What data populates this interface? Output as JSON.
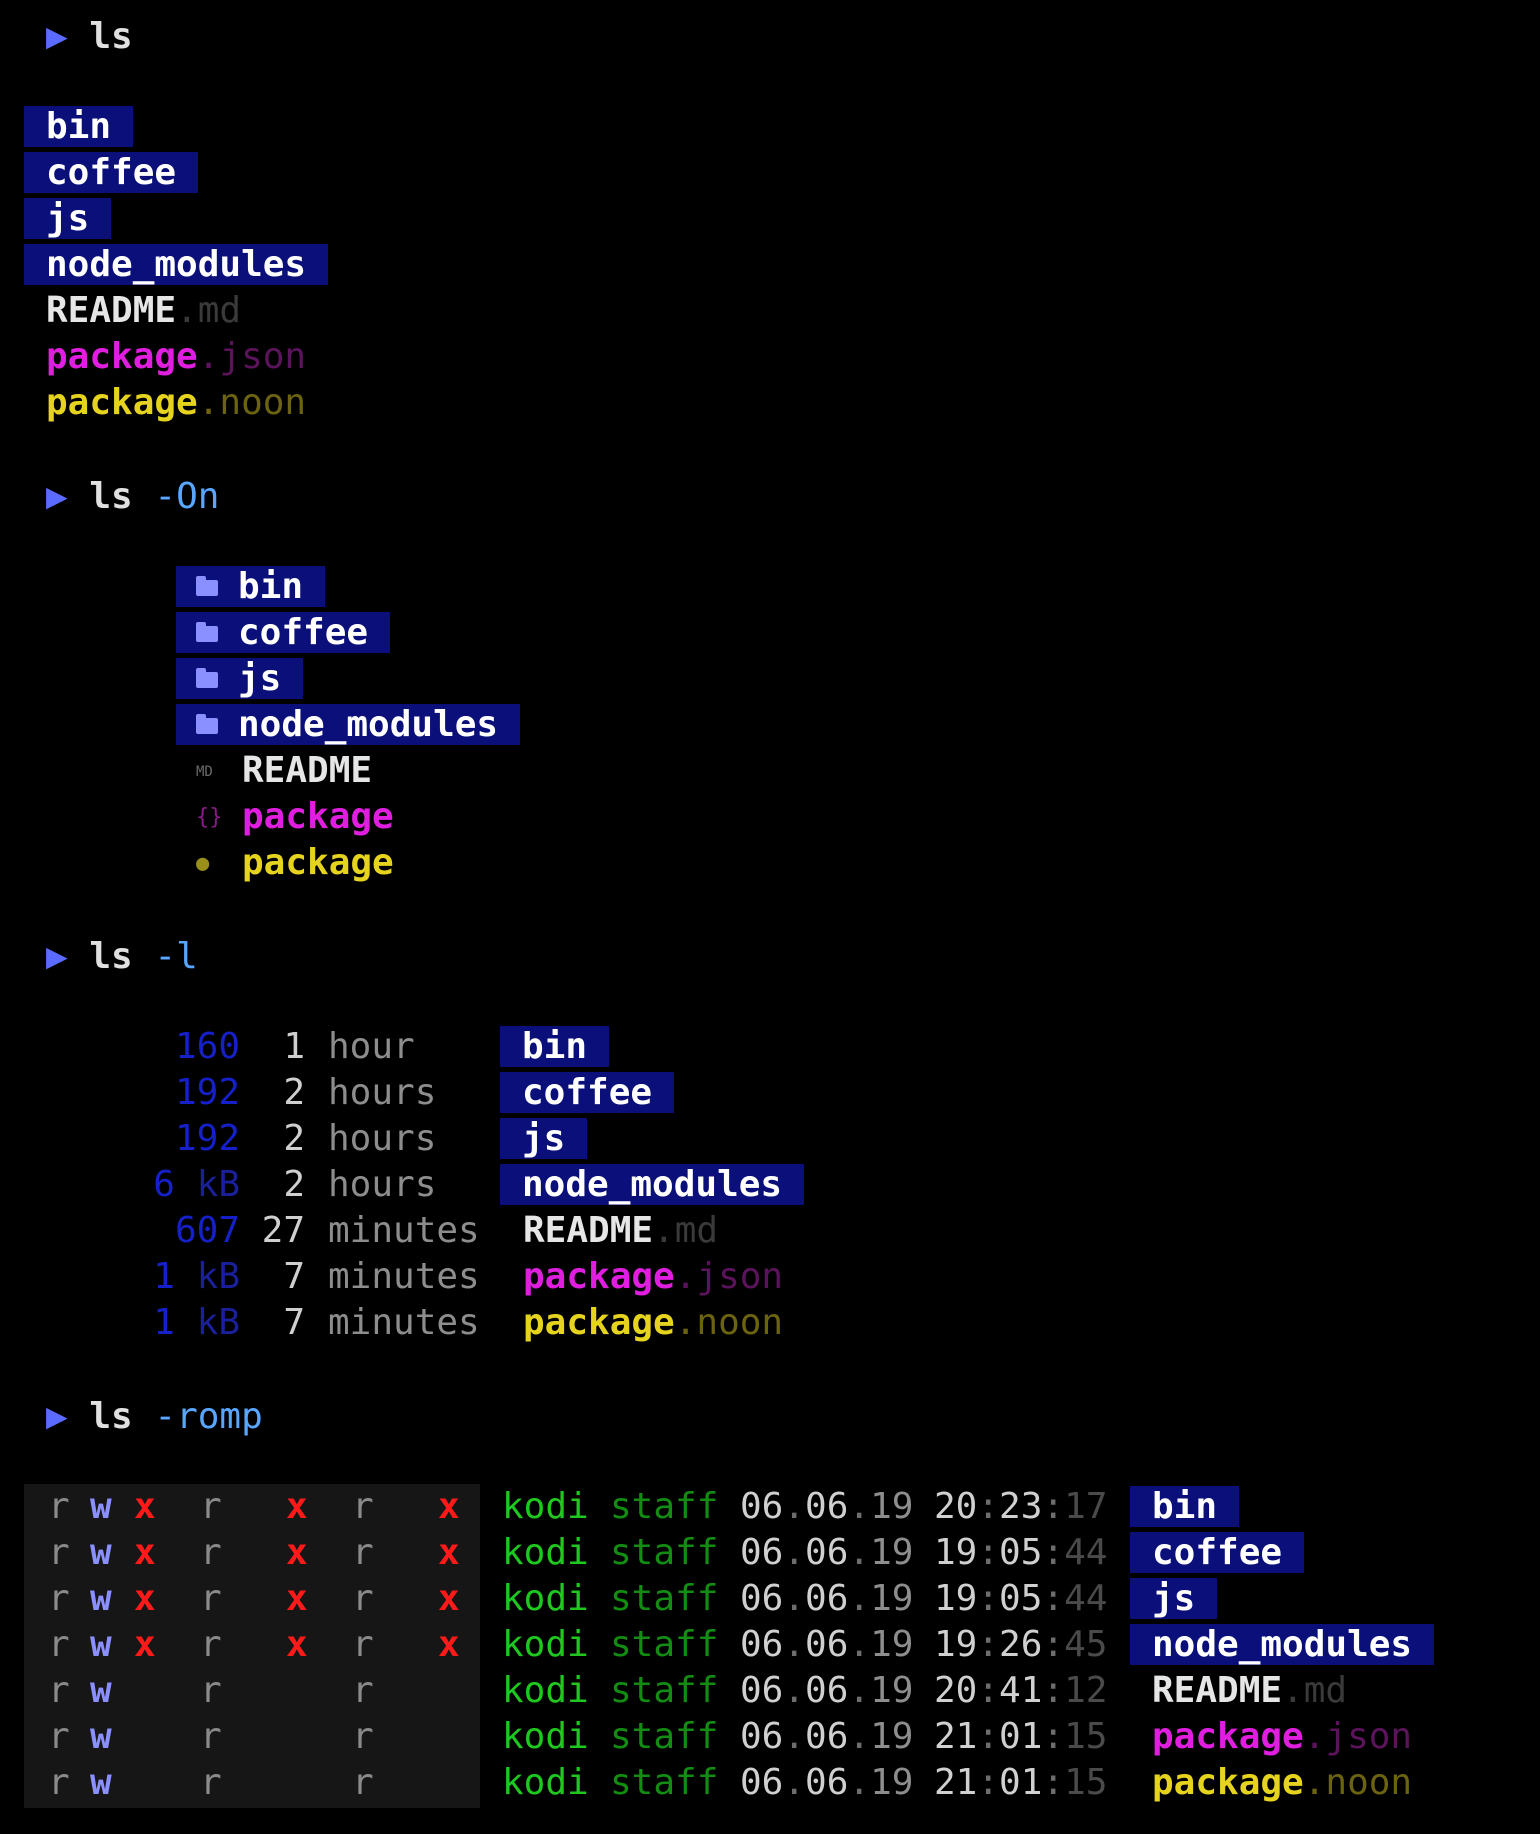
{
  "prompt_symbol": "▶",
  "sections": [
    {
      "cmd": "ls",
      "flag": ""
    },
    {
      "cmd": "ls",
      "flag": "-On"
    },
    {
      "cmd": "ls",
      "flag": "-l"
    },
    {
      "cmd": "ls",
      "flag": "-romp"
    }
  ],
  "dirs": [
    "bin",
    "coffee",
    "js",
    "node_modules"
  ],
  "files": [
    {
      "name": "README",
      "ext": ".md",
      "kind": "readme"
    },
    {
      "name": "package",
      "ext": ".json",
      "kind": "json"
    },
    {
      "name": "package",
      "ext": ".noon",
      "kind": "noon"
    }
  ],
  "icons": {
    "folder": "folder-icon",
    "markdown": "markdown-icon",
    "json": "json-icon",
    "noon": "noon-icon",
    "markdown_glyph": "MD",
    "json_glyph": "{}",
    "noon_glyph": "●"
  },
  "long_listing": [
    {
      "size_num": "160",
      "size_unit": "",
      "age_num": "1",
      "age_unit": "hour"
    },
    {
      "size_num": "192",
      "size_unit": "",
      "age_num": "2",
      "age_unit": "hours"
    },
    {
      "size_num": "192",
      "size_unit": "",
      "age_num": "2",
      "age_unit": "hours"
    },
    {
      "size_num": "6",
      "size_unit": "kB",
      "age_num": "2",
      "age_unit": "hours"
    },
    {
      "size_num": "607",
      "size_unit": "",
      "age_num": "27",
      "age_unit": "minutes"
    },
    {
      "size_num": "1",
      "size_unit": "kB",
      "age_num": "7",
      "age_unit": "minutes"
    },
    {
      "size_num": "1",
      "size_unit": "kB",
      "age_num": "7",
      "age_unit": "minutes"
    }
  ],
  "romp_listing": [
    {
      "perms": [
        "r",
        "w",
        "x",
        "r",
        "x",
        "r",
        "x"
      ],
      "owner": "kodi",
      "group": "staff",
      "date": [
        "06",
        "06",
        "19"
      ],
      "time": [
        "20",
        "23",
        "17"
      ]
    },
    {
      "perms": [
        "r",
        "w",
        "x",
        "r",
        "x",
        "r",
        "x"
      ],
      "owner": "kodi",
      "group": "staff",
      "date": [
        "06",
        "06",
        "19"
      ],
      "time": [
        "19",
        "05",
        "44"
      ]
    },
    {
      "perms": [
        "r",
        "w",
        "x",
        "r",
        "x",
        "r",
        "x"
      ],
      "owner": "kodi",
      "group": "staff",
      "date": [
        "06",
        "06",
        "19"
      ],
      "time": [
        "19",
        "05",
        "44"
      ]
    },
    {
      "perms": [
        "r",
        "w",
        "x",
        "r",
        "x",
        "r",
        "x"
      ],
      "owner": "kodi",
      "group": "staff",
      "date": [
        "06",
        "06",
        "19"
      ],
      "time": [
        "19",
        "26",
        "45"
      ]
    },
    {
      "perms": [
        "r",
        "w",
        "",
        "r",
        "",
        "r",
        ""
      ],
      "owner": "kodi",
      "group": "staff",
      "date": [
        "06",
        "06",
        "19"
      ],
      "time": [
        "20",
        "41",
        "12"
      ]
    },
    {
      "perms": [
        "r",
        "w",
        "",
        "r",
        "",
        "r",
        ""
      ],
      "owner": "kodi",
      "group": "staff",
      "date": [
        "06",
        "06",
        "19"
      ],
      "time": [
        "21",
        "01",
        "15"
      ]
    },
    {
      "perms": [
        "r",
        "w",
        "",
        "r",
        "",
        "r",
        ""
      ],
      "owner": "kodi",
      "group": "staff",
      "date": [
        "06",
        "06",
        "19"
      ],
      "time": [
        "21",
        "01",
        "15"
      ]
    }
  ],
  "colors": {
    "background": "#000000",
    "dir_bg": "#0b0f7a",
    "prompt": "#5c6bff",
    "flag": "#58a6ff",
    "json": "#e01ee0",
    "noon": "#e6d31e",
    "exec": "#ff1a1a",
    "owner": "#1ec81e"
  }
}
